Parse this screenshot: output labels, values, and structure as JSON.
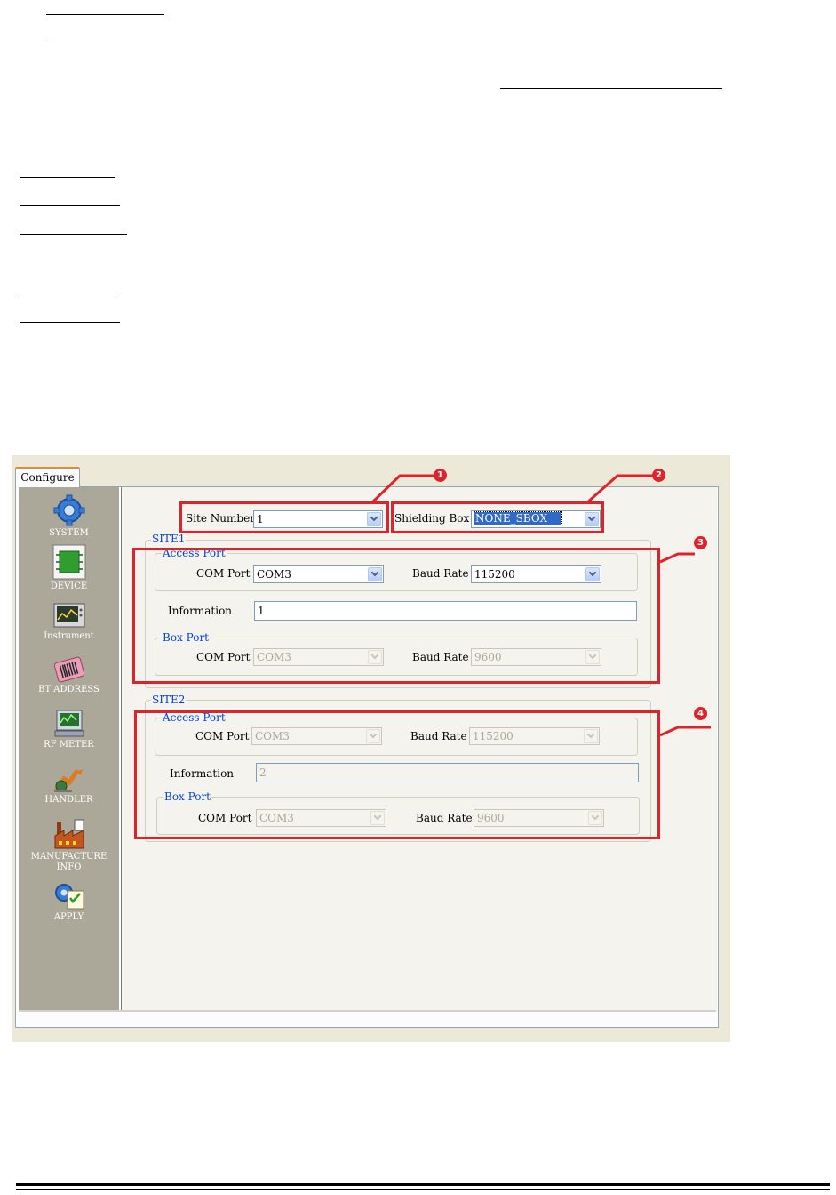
{
  "window": {
    "tab_label": "Configure"
  },
  "nav": [
    {
      "label": "SYSTEM",
      "icon": "gear-icon"
    },
    {
      "label": "DEVICE",
      "icon": "chip-icon"
    },
    {
      "label": "Instrument",
      "icon": "instrument-icon"
    },
    {
      "label": "BT ADDRESS",
      "icon": "barcode-icon"
    },
    {
      "label": "RF METER",
      "icon": "rf-meter-icon"
    },
    {
      "label": "HANDLER",
      "icon": "handler-icon"
    },
    {
      "label": "MANUFACTURE\nINFO",
      "icon": "factory-icon"
    },
    {
      "label": "APPLY",
      "icon": "apply-icon"
    }
  ],
  "top": {
    "site_number_label": "Site Number",
    "site_number_value": "1",
    "shielding_box_label": "Shielding Box",
    "shielding_box_value": "NONE_SBOX"
  },
  "site1": {
    "title": "SITE1",
    "access_port": {
      "title": "Access Port",
      "com_label": "COM Port",
      "com_value": "COM3",
      "baud_label": "Baud Rate",
      "baud_value": "115200"
    },
    "info_label": "Information",
    "info_value": "1",
    "box_port": {
      "title": "Box Port",
      "com_label": "COM Port",
      "com_value": "COM3",
      "baud_label": "Baud Rate",
      "baud_value": "9600"
    }
  },
  "site2": {
    "title": "SITE2",
    "access_port": {
      "title": "Access Port",
      "com_label": "COM Port",
      "com_value": "COM3",
      "baud_label": "Baud Rate",
      "baud_value": "115200"
    },
    "info_label": "Information",
    "info_value": "2",
    "box_port": {
      "title": "Box Port",
      "com_label": "COM Port",
      "com_value": "COM3",
      "baud_label": "Baud Rate",
      "baud_value": "9600"
    }
  },
  "callouts": [
    "1",
    "2",
    "3",
    "4"
  ],
  "colors": {
    "callout_red": "#e0222b",
    "group_title_blue": "#0046d5",
    "nav_bg": "#aca899"
  }
}
